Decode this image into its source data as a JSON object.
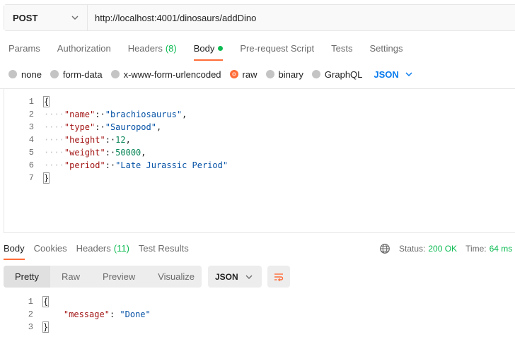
{
  "request": {
    "method": "POST",
    "url": "http://localhost:4001/dinosaurs/addDino"
  },
  "request_tabs": [
    {
      "label": "Params",
      "count": "",
      "active": false
    },
    {
      "label": "Authorization",
      "count": "",
      "active": false
    },
    {
      "label": "Headers",
      "count": "(8)",
      "active": false
    },
    {
      "label": "Body",
      "count": "",
      "active": true
    },
    {
      "label": "Pre-request Script",
      "count": "",
      "active": false
    },
    {
      "label": "Tests",
      "count": "",
      "active": false
    },
    {
      "label": "Settings",
      "count": "",
      "active": false
    }
  ],
  "body_types": [
    {
      "label": "none",
      "checked": false
    },
    {
      "label": "form-data",
      "checked": false
    },
    {
      "label": "x-www-form-urlencoded",
      "checked": false
    },
    {
      "label": "raw",
      "checked": true
    },
    {
      "label": "binary",
      "checked": false
    },
    {
      "label": "GraphQL",
      "checked": false
    }
  ],
  "body_format": "JSON",
  "request_body_lines": [
    {
      "n": "1",
      "text": "{"
    },
    {
      "n": "2",
      "key": "\"name\"",
      "value": "\"brachiosaurus\"",
      "value_type": "str",
      "comma": true
    },
    {
      "n": "3",
      "key": "\"type\"",
      "value": "\"Sauropod\"",
      "value_type": "str",
      "comma": true
    },
    {
      "n": "4",
      "key": "\"height\"",
      "value": "12",
      "value_type": "num",
      "comma": true
    },
    {
      "n": "5",
      "key": "\"weight\"",
      "value": "50000",
      "value_type": "num",
      "comma": true
    },
    {
      "n": "6",
      "key": "\"period\"",
      "value": "\"Late Jurassic Period\"",
      "value_type": "str",
      "comma": false
    },
    {
      "n": "7",
      "text": "}"
    }
  ],
  "response_tabs": [
    {
      "label": "Body",
      "count": "",
      "active": true
    },
    {
      "label": "Cookies",
      "count": "",
      "active": false
    },
    {
      "label": "Headers",
      "count": "(11)",
      "active": false
    },
    {
      "label": "Test Results",
      "count": "",
      "active": false
    }
  ],
  "response_status": {
    "status_label": "Status:",
    "status_value": "200 OK",
    "time_label": "Time:",
    "time_value": "64 ms"
  },
  "response_views": [
    "Pretty",
    "Raw",
    "Preview",
    "Visualize"
  ],
  "response_format": "JSON",
  "response_body_lines": [
    {
      "n": "1",
      "text": "{"
    },
    {
      "n": "2",
      "key": "\"message\"",
      "value": "\"Done\"",
      "value_type": "str",
      "comma": false
    },
    {
      "n": "3",
      "text": "}"
    }
  ],
  "colors": {
    "accent": "#ff6c37",
    "success": "#0cbb52",
    "link": "#097bed"
  }
}
